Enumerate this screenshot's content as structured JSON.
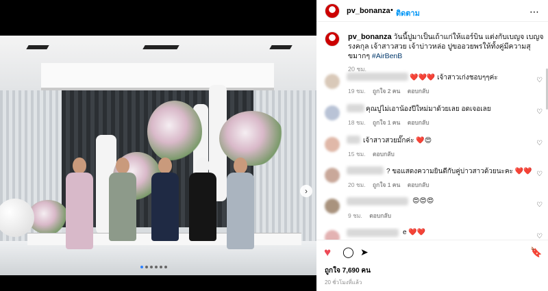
{
  "post": {
    "username": "pv_bonanza",
    "follow_label": "ติดตาม",
    "caption_text": "วันนี้ปูมาเป็นเถ้าแก่ให้แอร์บิน แต่งกับเบญจ เบญจรงคกุล เจ้าสาวสวย เจ้าบ่าวหล่อ ปูขออวยพรให้ทั้งคู่มีความสุขมากๆ",
    "caption_tag": "#AirBenB",
    "caption_time": "20 ชม.",
    "likes_text": "ถูกใจ 7,690 คน",
    "posted_time": "20 ชั่วโมงที่แล้ว"
  },
  "comments": [
    {
      "text": "❤️❤️❤️ เจ้าสาวเก่งชอบๆๆค่ะ",
      "time": "19 ชม.",
      "likes": "ถูกใจ 2 คน",
      "reply": "ตอบกลับ"
    },
    {
      "text": "คุณปูไม่เอาน้องปีใหม่มาด้วยเลย อดเจอเลย",
      "time": "18 ชม.",
      "likes": "ถูกใจ 1 คน",
      "reply": "ตอบกลับ"
    },
    {
      "text": "เจ้าสาวสวยมั๊กค่ะ ❤️😍",
      "time": "15 ชม.",
      "likes": "",
      "reply": "ตอบกลับ"
    },
    {
      "text": "? ขอแสดงความยินดีกับคู่บ่าวสาวด้วยนะคะ ❤️❤️",
      "time": "20 ชม.",
      "likes": "ถูกใจ 1 คน",
      "reply": "ตอบกลับ"
    },
    {
      "text": "😍😍😍",
      "time": "9 ชม.",
      "likes": "",
      "reply": "ตอบกลับ"
    },
    {
      "text": "e ❤️❤️",
      "time": "",
      "likes": "",
      "reply": ""
    }
  ],
  "icons": {
    "more": "⋯",
    "heart_filled": "♥",
    "heart_outline": "♡",
    "comment": "◯",
    "share": "➤",
    "bookmark": "🔖",
    "next": "›"
  },
  "colors": {
    "like_red": "#ed4956",
    "link_blue": "#0095f6",
    "hashtag": "#00376b"
  }
}
